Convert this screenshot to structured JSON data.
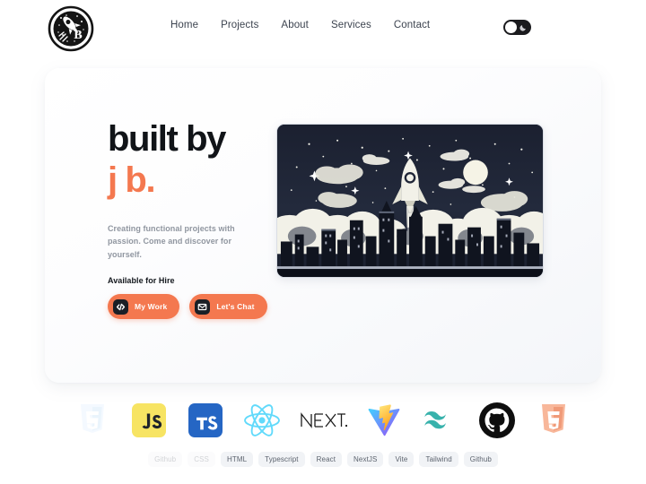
{
  "header": {
    "logo": {
      "name": "brand-logo",
      "letter": "B",
      "alt": "rocket-badge-logo"
    },
    "nav": [
      {
        "label": "Home"
      },
      {
        "label": "Projects"
      },
      {
        "label": "About"
      },
      {
        "label": "Services"
      },
      {
        "label": "Contact"
      }
    ],
    "theme_toggle": {
      "state": "light",
      "icon": "moon-icon"
    }
  },
  "hero": {
    "title_line1": "built by",
    "title_line2": "j b.",
    "description": "Creating functional projects with passion. Come and discover for yourself.",
    "availability": "Available for Hire",
    "buttons": [
      {
        "label": "My Work",
        "icon": "code-icon"
      },
      {
        "label": "Let's Chat",
        "icon": "envelope-icon"
      }
    ],
    "artwork": {
      "name": "rocket-launch-city-illustration",
      "description": "Rocket launching above a night city skyline with clouds, stars and a moon"
    }
  },
  "tech_stack": {
    "icons": [
      {
        "name": "css3-icon",
        "label": "CSS",
        "faded": true
      },
      {
        "name": "javascript-icon",
        "label": "JS",
        "faded": false
      },
      {
        "name": "typescript-icon",
        "label": "TS",
        "faded": false
      },
      {
        "name": "react-icon",
        "label": "React",
        "faded": false
      },
      {
        "name": "nextjs-icon",
        "label": "NEXT.js",
        "faded": false
      },
      {
        "name": "vite-icon",
        "label": "Vite",
        "faded": false
      },
      {
        "name": "tailwind-icon",
        "label": "Tailwind",
        "faded": false
      },
      {
        "name": "github-icon",
        "label": "Github",
        "faded": false
      },
      {
        "name": "html5-icon",
        "label": "HTML",
        "faded": false
      }
    ],
    "chips": [
      {
        "label": "Github",
        "faded": true
      },
      {
        "label": "CSS",
        "faded": true
      },
      {
        "label": "HTML",
        "faded": false
      },
      {
        "label": "Typescript",
        "faded": false
      },
      {
        "label": "React",
        "faded": false
      },
      {
        "label": "NextJS",
        "faded": false
      },
      {
        "label": "Vite",
        "faded": false
      },
      {
        "label": "Tailwind",
        "faded": false
      },
      {
        "label": "Github",
        "faded": false
      }
    ]
  },
  "colors": {
    "accent": "#f4784f",
    "text_dark": "#111418",
    "text_muted": "#9096a0",
    "card_bg": "#f4f6f9",
    "toggle_bg": "#1b1b1e"
  }
}
